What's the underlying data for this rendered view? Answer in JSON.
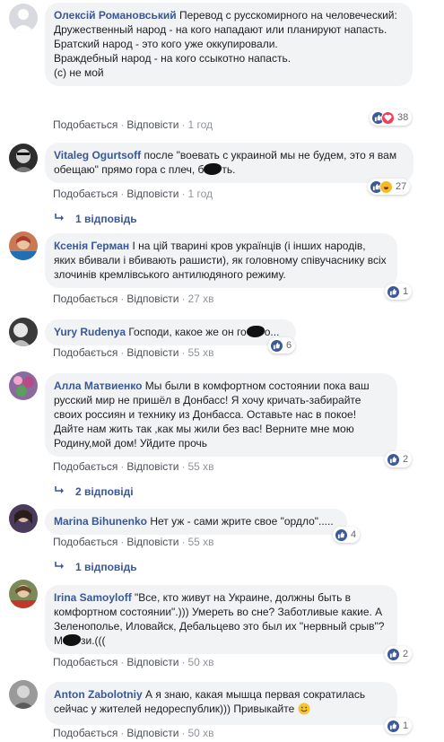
{
  "action_like": "Подобається",
  "action_reply": "Відповісти",
  "comments": [
    {
      "author": "Олексій Романовський",
      "text": " Перевод с русскомирного на человеческий:\nДружественный народ - на кого нападают или планируют напасть.\nБратский народ - это кого уже оккупировали.\nВраждебный народ - на кого ссыкотно напасть.\n(с) не мой",
      "time": "1 год",
      "reaction_count": "38",
      "avatar_color": "#d8dadf"
    },
    {
      "author": "Vitaleg Ogurtsoff",
      "text": " после \"воевать с украиной мы не будем, это я вам обещаю\" прямо гора с плеч, б",
      "text_end": "ть.",
      "time": "1 год",
      "reaction_count": "27",
      "replies": "1 відповідь",
      "avatar_color": "#2d2d2d"
    },
    {
      "author": "Ксенія Герман",
      "text": " І на цій тварині кров українців (і інших народів, яких вбивали і вбивають рашисти), як головному співучаснику всіх злочинів кремлівського антилюдяного режиму.",
      "time": "27 хв",
      "reaction_count": "1",
      "avatar_color": "#c97a54"
    },
    {
      "author": "Yury Rudenya",
      "text": " Господи, какое же он го",
      "text_end": "о...",
      "time": "55 хв",
      "reaction_count": "6",
      "avatar_color": "#3a3a3a"
    },
    {
      "author": "Алла Матвиенко",
      "text": " Мы были в комфортном состоянии пока ваш русский мир не пришёл в Донбасс! Я хочу кричать-забирайте своих россиян и технику из Донбасса. Оставьте нас в покое! Дайте нам жить так ,как мы жили без вас! Верните мне мою Родину,мой дом! Уйдите прочь",
      "time": "55 хв",
      "reaction_count": "2",
      "replies": "2 відповіді",
      "avatar_color": "#8a6b9e"
    },
    {
      "author": "Marina Bihunenko",
      "text": " Нет уж - сами жрите свое \"ордло\".....",
      "time": "55 хв",
      "reaction_count": "4",
      "replies": "1 відповідь",
      "avatar_color": "#4a3b5c"
    },
    {
      "author": "Irina Samoyloff",
      "text": " \"Все, кто живут на Украине, должны быть в комфортном состоянии\".))) Умереть во сне? Заботливые какие. А Зеленополье, Иловайск, Дебальцево это был их \"нервный срыв\"? М",
      "text_end": "зи.(((",
      "time": "50 хв",
      "reaction_count": "2",
      "avatar_color": "#7c8a5a"
    },
    {
      "author": "Anton Zabolotniy",
      "text": " А я знаю, какая мышца первая сократилась сейчас у жителей недореспублик))) Привыкайте ",
      "time": "50 хв",
      "reaction_count": "1",
      "avatar_color": "#9a9a9a"
    }
  ]
}
